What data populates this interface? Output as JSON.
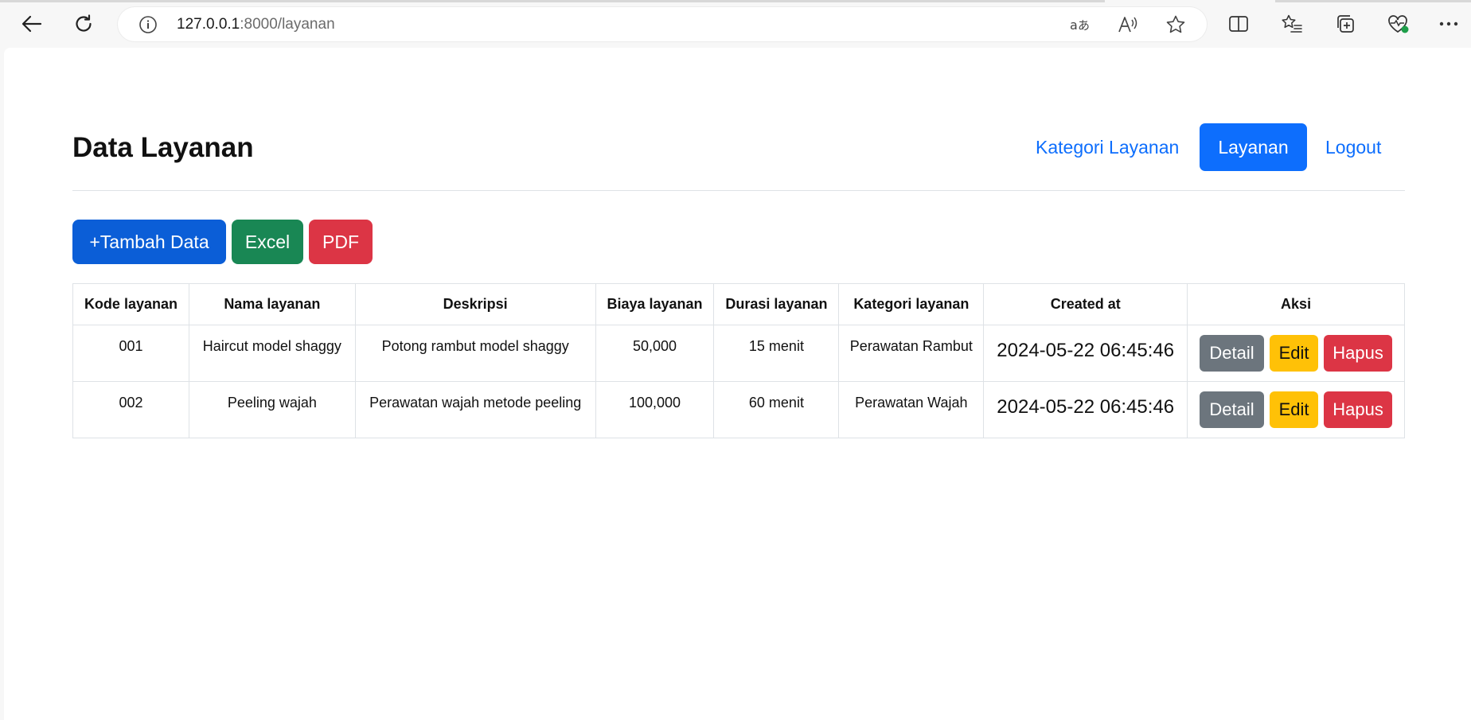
{
  "browser": {
    "url_host": "127.0.0.1",
    "url_path": ":8000/layanan"
  },
  "page": {
    "title": "Data Layanan",
    "nav": {
      "kategori": "Kategori Layanan",
      "layanan": "Layanan",
      "logout": "Logout"
    },
    "toolbar": {
      "add": "+Tambah Data",
      "excel": "Excel",
      "pdf": "PDF"
    }
  },
  "table": {
    "headers": [
      "Kode layanan",
      "Nama layanan",
      "Deskripsi",
      "Biaya layanan",
      "Durasi layanan",
      "Kategori layanan",
      "Created at",
      "Aksi"
    ],
    "rows": [
      {
        "kode": "001",
        "nama": "Haircut model shaggy",
        "deskripsi": "Potong rambut model shaggy",
        "biaya": "50,000",
        "durasi": "15 menit",
        "kategori": "Perawatan Rambut",
        "created": "2024-05-22 06:45:46"
      },
      {
        "kode": "002",
        "nama": "Peeling wajah",
        "deskripsi": "Perawatan wajah metode peeling",
        "biaya": "100,000",
        "durasi": "60 menit",
        "kategori": "Perawatan Wajah",
        "created": "2024-05-22 06:45:46"
      }
    ],
    "actions": {
      "detail": "Detail",
      "edit": "Edit",
      "hapus": "Hapus"
    }
  },
  "colors": {
    "primary": "#0d6efd",
    "success": "#198754",
    "danger": "#dc3545",
    "warning": "#ffc107",
    "secondary": "#6c757d"
  }
}
